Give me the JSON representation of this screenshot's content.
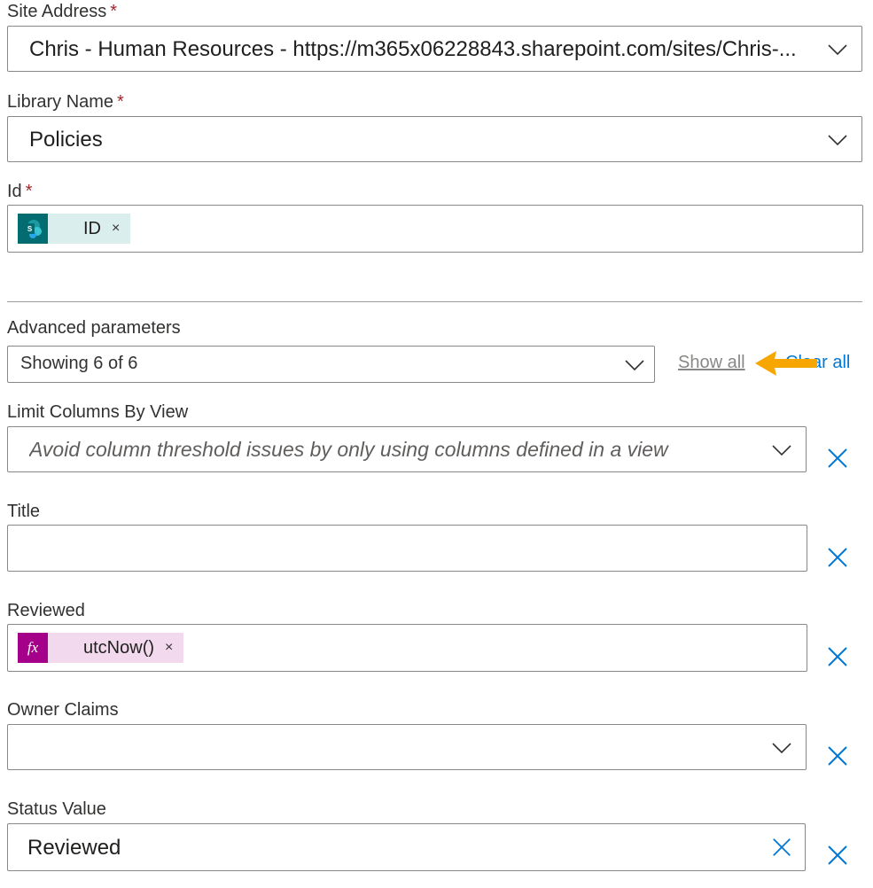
{
  "site_address": {
    "label": "Site Address",
    "required_mark": "*",
    "value": "Chris - Human Resources - https://m365x06228843.sharepoint.com/sites/Chris-..."
  },
  "library_name": {
    "label": "Library Name",
    "required_mark": "*",
    "value": "Policies"
  },
  "id_field": {
    "label": "Id",
    "required_mark": "*",
    "token_label": "ID",
    "token_remove": "×",
    "token_icon": "sharepoint-icon",
    "token_color": "#dbeeee",
    "icon_color": "#036c70"
  },
  "advanced": {
    "label": "Advanced parameters",
    "showing": "Showing 6 of 6",
    "show_all": "Show all",
    "clear_all": "Clear all"
  },
  "limit_columns": {
    "label": "Limit Columns By View",
    "placeholder": "Avoid column threshold issues by only using columns defined in a view"
  },
  "title_field": {
    "label": "Title",
    "value": ""
  },
  "reviewed": {
    "label": "Reviewed",
    "token_label": "utcNow()",
    "token_remove": "×",
    "token_icon": "fx-icon",
    "icon_glyph": "fx",
    "token_color": "#f2d9ee",
    "icon_color": "#a4008a"
  },
  "owner_claims": {
    "label": "Owner Claims",
    "value": ""
  },
  "status_value": {
    "label": "Status Value",
    "value": "Reviewed"
  },
  "colors": {
    "accent": "#0078d4",
    "arrow": "#f7a600",
    "required": "#a4262c"
  }
}
